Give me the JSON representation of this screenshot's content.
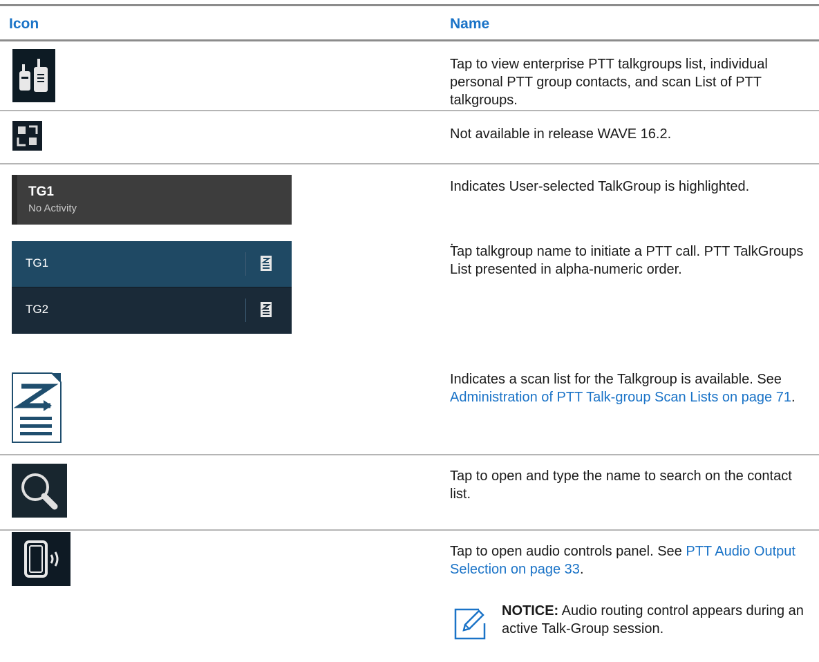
{
  "table": {
    "headers": {
      "icon": "Icon",
      "name": "Name"
    },
    "rows": [
      {
        "icon_name": "ptt-radios-icon",
        "description": "Tap to view enterprise PTT talkgroups list, individual personal PTT group contacts, and scan List of PTT talkgroups."
      },
      {
        "icon_name": "favorites-grid-icon",
        "description": "Not available in release WAVE 16.2."
      },
      {
        "icon_name": "talkgroup-highlight-tile",
        "tile_title": "TG1",
        "tile_subtitle": "No Activity",
        "description": "Indicates User-selected TalkGroup is highlighted.",
        "trailing": "."
      },
      {
        "icon_name": "talkgroup-list-tile",
        "items": [
          "TG1",
          "TG2"
        ],
        "description": "Tap talkgroup name to initiate a PTT call. PTT TalkGroups List presented in alpha-numeric order."
      },
      {
        "icon_name": "scan-list-icon",
        "description_prefix": "Indicates a scan list for the Talkgroup is available. See ",
        "link_text": "Administration of PTT Talk-group Scan Lists on page 71",
        "description_suffix": "."
      },
      {
        "icon_name": "search-icon",
        "description": "Tap to open and type the name to search on the contact list."
      },
      {
        "icon_name": "audio-output-icon",
        "description_prefix": "Tap to open audio controls panel. See ",
        "link_text": "PTT Audio Output Selection on page 33",
        "description_suffix": ".",
        "notice_label": "NOTICE:",
        "notice_text": " Audio routing control appears during an active Talk-Group session."
      }
    ]
  },
  "colors": {
    "header_text": "#1a73c7",
    "link": "#1a73c7",
    "rule": "#8c8c8c"
  }
}
